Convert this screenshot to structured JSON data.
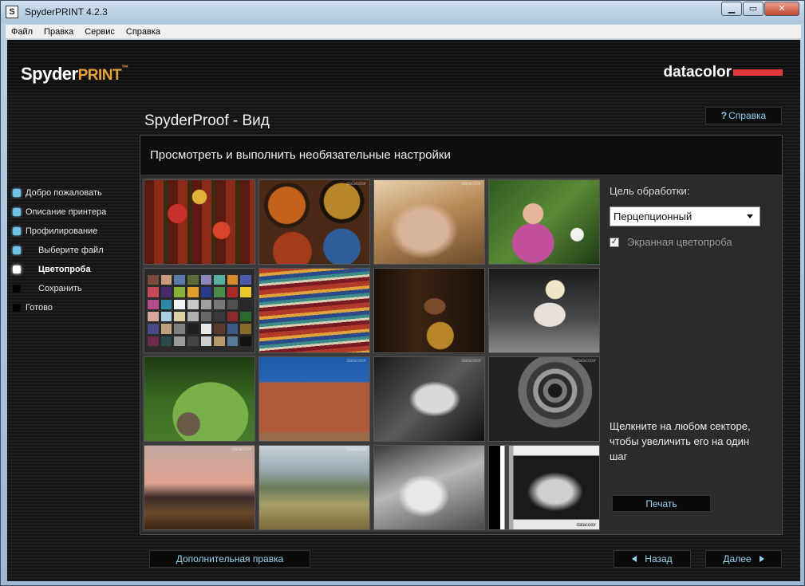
{
  "window": {
    "title": "SpyderPRINT 4.2.3",
    "icon_letter": "S",
    "controls": {
      "minimize": "▁",
      "maximize": "▭",
      "close": "✕"
    }
  },
  "menu": [
    "Файл",
    "Правка",
    "Сервис",
    "Справка"
  ],
  "branding": {
    "product_main": "Spyder",
    "product_accent": "PRINT",
    "trademark": "™",
    "company": "datacolor"
  },
  "sidebar": {
    "steps": [
      {
        "label": "Добро пожаловать",
        "state": "done"
      },
      {
        "label": "Описание принтера",
        "state": "done"
      },
      {
        "label": "Профилирование",
        "state": "done"
      },
      {
        "label": "Выберите файл",
        "state": "done",
        "sub": true
      },
      {
        "label": "Цветопроба",
        "state": "current",
        "sub": true
      },
      {
        "label": "Сохранить",
        "state": "pending",
        "sub": true
      },
      {
        "label": "Готово",
        "state": "pending"
      }
    ]
  },
  "page": {
    "title": "SpyderProof - Вид",
    "help_label": "Справка",
    "panel_heading": "Просмотреть и выполнить необязательные настройки"
  },
  "tiles": [
    {
      "name": "peppers",
      "watermark": ""
    },
    {
      "name": "painted-plates",
      "watermark": "datacolor"
    },
    {
      "name": "woman-face",
      "watermark": "datacolor"
    },
    {
      "name": "girl-flowers",
      "watermark": ""
    },
    {
      "name": "color-checker",
      "watermark": ""
    },
    {
      "name": "textiles",
      "watermark": ""
    },
    {
      "name": "guitar-player",
      "watermark": ""
    },
    {
      "name": "marilyn-collage",
      "watermark": ""
    },
    {
      "name": "garden-urn",
      "watermark": ""
    },
    {
      "name": "adobe-church",
      "watermark": "datacolor"
    },
    {
      "name": "bw-portrait",
      "watermark": "datacolor"
    },
    {
      "name": "spiral-staircase",
      "watermark": "datacolor"
    },
    {
      "name": "sunset-field",
      "watermark": "datacolor"
    },
    {
      "name": "tuscan-hills",
      "watermark": "datacolor"
    },
    {
      "name": "scooter-bw",
      "watermark": ""
    },
    {
      "name": "bw-test-chart",
      "watermark": "datacolor"
    }
  ],
  "controls": {
    "intent_label": "Цель обработки:",
    "intent_value": "Перцепционный",
    "softproof_label": "Экранная цветопроба",
    "softproof_checked": true,
    "hint": "Щелкните на любом секторе, чтобы увеличить его на один шаг",
    "print_label": "Печать"
  },
  "footer": {
    "extra_help": "Дополнительная правка",
    "back": "Назад",
    "next": "Далее"
  },
  "colors": {
    "accent_blue": "#9ad6f2",
    "step_done": "#6fc1e6",
    "brand_orange": "#e8a23a",
    "brand_red": "#e03a3a"
  },
  "checker_colors": [
    "#7a4a3a",
    "#c89a80",
    "#5a78a8",
    "#5a6a3a",
    "#8a88b8",
    "#5ab0a0",
    "#d88a2a",
    "#4a5aa8",
    "#c84a5a",
    "#4a2a6a",
    "#8ab03a",
    "#e0a02a",
    "#2a3a8a",
    "#4a8a4a",
    "#a82a2a",
    "#e8c82a",
    "#b84a8a",
    "#2a8aa8",
    "#f2f2f2",
    "#c8c8c8",
    "#a0a0a0",
    "#787878",
    "#505050",
    "#282828",
    "#d8a8a0",
    "#a8d0e0",
    "#e0d0a8",
    "#b0b0b0",
    "#686868",
    "#3a3a3a",
    "#8a2a2a",
    "#2a6a2a",
    "#4a4a8a",
    "#c0a080",
    "#808080",
    "#202020",
    "#e8e8e8",
    "#5a3a2a",
    "#3a5a8a",
    "#8a6a2a",
    "#6a2a4a",
    "#2a4a4a",
    "#9a9a9a",
    "#444444",
    "#cfcfcf",
    "#b89a6a",
    "#587a9a",
    "#121212"
  ]
}
